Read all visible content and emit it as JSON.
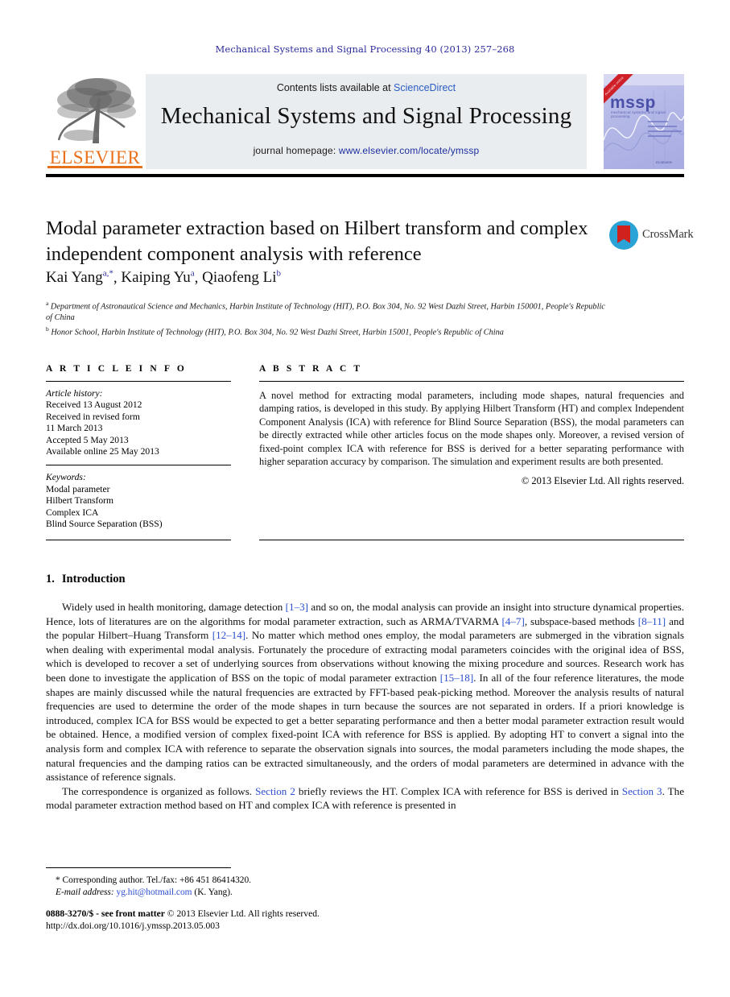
{
  "running_head": "Mechanical Systems and Signal Processing 40 (2013) 257–268",
  "header": {
    "publisher_name": "ELSEVIER",
    "contents_prefix": "Contents lists available at ",
    "contents_link": "ScienceDirect",
    "journal_name": "Mechanical Systems and Signal Processing",
    "homepage_prefix": "journal homepage: ",
    "homepage_link": "www.elsevier.com/locate/ymssp",
    "cover": {
      "title": "mssp",
      "subtitle": "mechanical systems and signal processing",
      "banner": "Available online",
      "imprint": "ELSEVIER"
    }
  },
  "article": {
    "title": "Modal parameter extraction based on Hilbert transform and complex independent component analysis with reference",
    "authors": [
      {
        "name": "Kai Yang",
        "marks": "a,*"
      },
      {
        "name": "Kaiping Yu",
        "marks": "a"
      },
      {
        "name": "Qiaofeng Li",
        "marks": "b"
      }
    ],
    "affiliations": [
      {
        "mark": "a",
        "text": "Department of Astronautical Science and Mechanics, Harbin Institute of Technology (HIT), P.O. Box 304, No. 92 West Dazhi Street, Harbin 150001, People's Republic of China"
      },
      {
        "mark": "b",
        "text": "Honor School, Harbin Institute of Technology (HIT), P.O. Box 304, No. 92 West Dazhi Street, Harbin 15001, People's Republic of China"
      }
    ],
    "crossmark_label": "CrossMark"
  },
  "info": {
    "heading": "A R T I C L E    I N F O",
    "history_label": "Article history:",
    "history": [
      "Received 13 August 2012",
      "Received in revised form",
      "11 March 2013",
      "Accepted 5 May 2013",
      "Available online 25 May 2013"
    ],
    "keywords_label": "Keywords:",
    "keywords": [
      "Modal parameter",
      "Hilbert Transform",
      "Complex ICA",
      "Blind Source Separation (BSS)"
    ]
  },
  "abstract": {
    "heading": "A B S T R A C T",
    "text": "A novel method for extracting modal parameters, including mode shapes, natural frequencies and damping ratios, is developed in this study. By applying Hilbert Transform (HT) and complex Independent Component Analysis (ICA) with reference for Blind Source Separation (BSS), the modal parameters can be directly extracted while other articles focus on the mode shapes only. Moreover, a revised version of fixed-point complex ICA with reference for BSS is derived for a better separating performance with higher separation accuracy by comparison. The simulation and experiment results are both presented.",
    "copyright": "© 2013 Elsevier Ltd. All rights reserved."
  },
  "body": {
    "section_number": "1.",
    "section_title": "Introduction",
    "paragraph1_parts": [
      "Widely used in health monitoring, damage detection ",
      "[1–3]",
      " and so on, the modal analysis can provide an insight into structure dynamical properties. Hence, lots of literatures are on the algorithms for modal parameter extraction, such as ARMA/TVARMA ",
      "[4–7]",
      ", subspace-based methods ",
      "[8–11]",
      " and the popular Hilbert–Huang Transform ",
      "[12–14]",
      ". No matter which method ones employ, the modal parameters are submerged in the vibration signals when dealing with experimental modal analysis. Fortunately the procedure of extracting modal parameters coincides with the original idea of BSS, which is developed to recover a set of underlying sources from observations without knowing the mixing procedure and sources. Research work has been done to investigate the application of BSS on the topic of modal parameter extraction ",
      "[15–18]",
      ". In all of the four reference literatures, the mode shapes are mainly discussed while the natural frequencies are extracted by FFT-based peak-picking method. Moreover the analysis results of natural frequencies are used to determine the order of the mode shapes in turn because the sources are not separated in orders. If a priori knowledge is introduced, complex ICA for BSS would be expected to get a better separating performance and then a better modal parameter extraction result would be obtained. Hence, a modified version of complex fixed-point ICA with reference for BSS is applied. By adopting HT to convert a signal into the analysis form and complex ICA with reference to separate the observation signals into sources, the modal parameters including the mode shapes, the natural frequencies and the damping ratios can be extracted simultaneously, and the orders of modal parameters are determined in advance with the assistance of reference signals."
    ],
    "paragraph2_parts": [
      "The correspondence is organized as follows. ",
      "Section 2",
      " briefly reviews the HT. Complex ICA with reference for BSS is derived in ",
      "Section 3",
      ". The modal parameter extraction method based on HT and complex ICA with reference is presented in"
    ]
  },
  "footnote": {
    "corresponding": "* Corresponding author. Tel./fax: +86 451 86414320.",
    "email_label": "E-mail address:",
    "email": "yg.hit@hotmail.com",
    "email_suffix": "(K. Yang)."
  },
  "footer": {
    "issn_line_bold": "0888-3270/$ - see front matter",
    "issn_line_rest": " © 2013 Elsevier Ltd. All rights reserved.",
    "doi": "http://dx.doi.org/10.1016/j.ymssp.2013.05.003"
  },
  "colors": {
    "link_blue": "#2b4fd0",
    "sciencedirect_blue": "#2b5cc4",
    "homepage_navy": "#1d2f9e",
    "elsevier_orange": "#E9711C",
    "running_head_blue": "#2b2b9c",
    "crossmark_red": "#d0211c",
    "crossmark_blue": "#2aa4d6",
    "masthead_grey": "#e9edef"
  }
}
